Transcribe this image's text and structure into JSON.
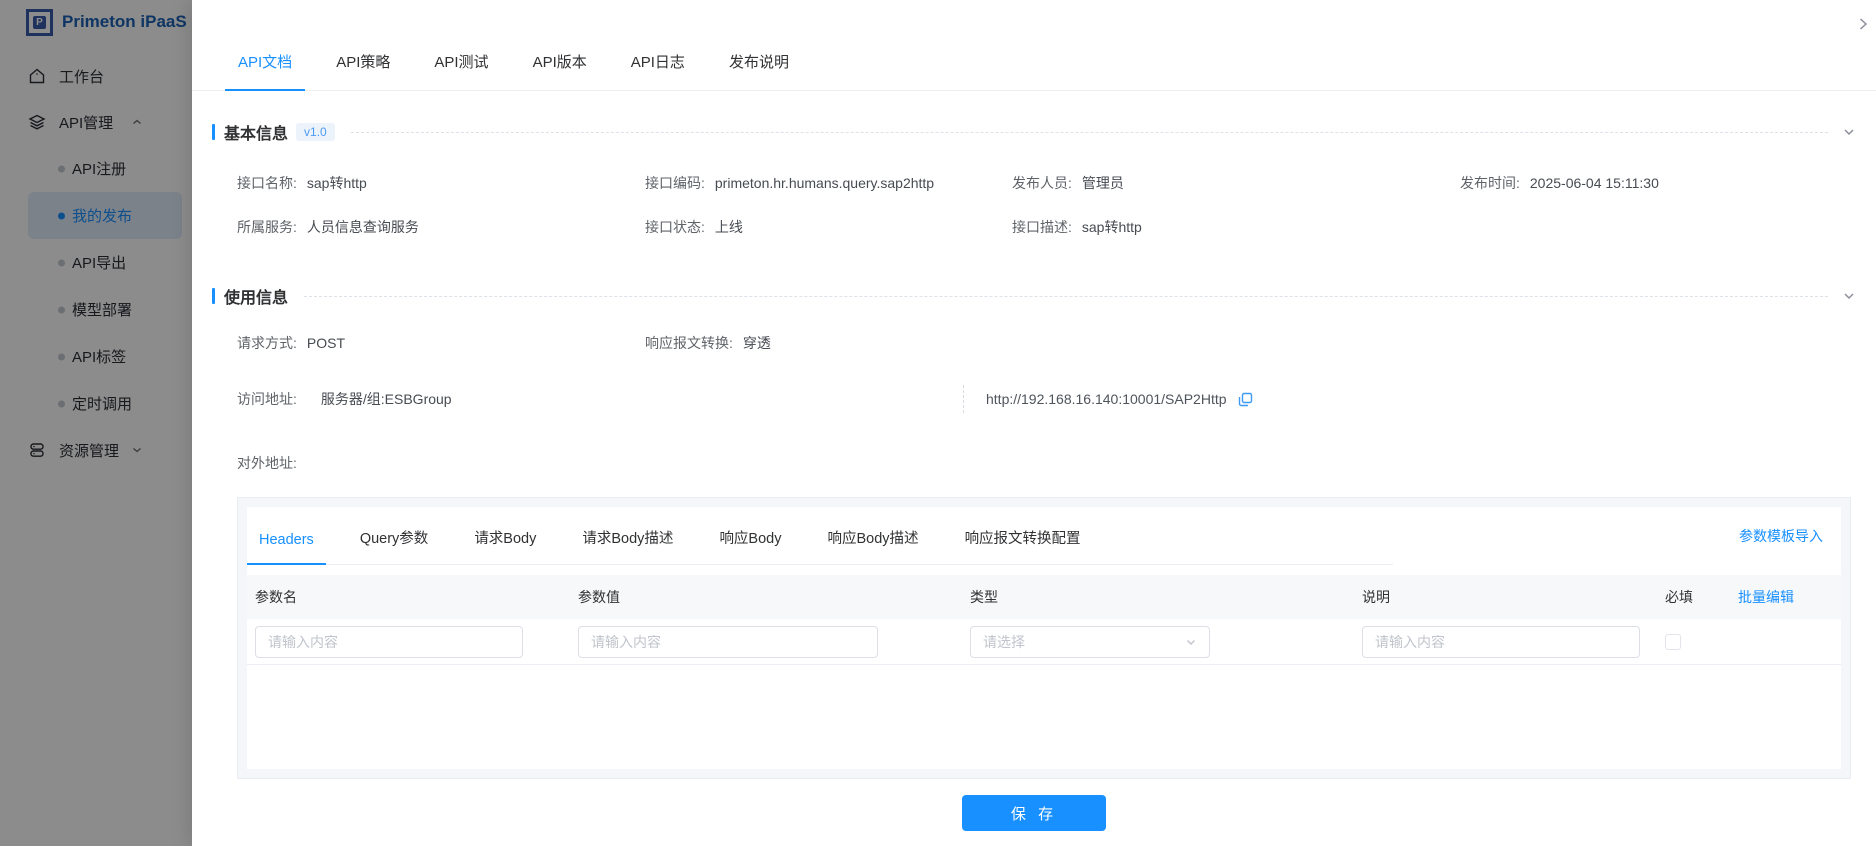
{
  "colors": {
    "accent": "#1890ff",
    "link": "#1890ff",
    "save_button_bg": "#1890ff",
    "active_menu_bg": "#e2edfb"
  },
  "icons": {
    "logo-cube-icon": "framed P cube",
    "home-icon": "house",
    "layers-icon": "stacked layers",
    "database-icon": "server stack",
    "chevron-up-icon": "^",
    "chevron-down-icon": "v",
    "chevron-right-icon": ">",
    "copy-icon": "two overlapping squares",
    "select-arrow-icon": "v"
  },
  "sidebar": {
    "logo": {
      "text": "Primeton iPaaS",
      "letter": "P"
    },
    "menu": [
      {
        "label": "工作台"
      },
      {
        "label": "API管理"
      },
      {
        "label": "资源管理"
      }
    ],
    "submenu": [
      {
        "label": "API注册"
      },
      {
        "label": "我的发布"
      },
      {
        "label": "API导出"
      },
      {
        "label": "模型部署"
      },
      {
        "label": "API标签"
      },
      {
        "label": "定时调用"
      }
    ]
  },
  "drawer": {
    "tabs": [
      "API文档",
      "API策略",
      "API测试",
      "API版本",
      "API日志",
      "发布说明"
    ],
    "basic_info": {
      "title": "基本信息",
      "version_badge": "v1.0",
      "row1": [
        {
          "label": "接口名称:",
          "value": "sap转http"
        },
        {
          "label": "接口编码:",
          "value": "primeton.hr.humans.query.sap2http"
        },
        {
          "label": "发布人员:",
          "value": "管理员"
        },
        {
          "label": "发布时间:",
          "value": "2025-06-04 15:11:30"
        }
      ],
      "row2": [
        {
          "label": "所属服务:",
          "value": "人员信息查询服务"
        },
        {
          "label": "接口状态:",
          "value": "上线"
        },
        {
          "label": "接口描述:",
          "value": "sap转http"
        }
      ]
    },
    "usage_info": {
      "title": "使用信息",
      "row1": [
        {
          "label": "请求方式:",
          "value": "POST"
        },
        {
          "label": "响应报文转换:",
          "value": "穿透"
        }
      ],
      "access": {
        "label": "访问地址:",
        "server": "服务器/组:ESBGroup",
        "url": "http://192.168.16.140:10001/SAP2Http"
      },
      "external": {
        "label": "对外地址:"
      }
    },
    "params": {
      "tabs": [
        "Headers",
        "Query参数",
        "请求Body",
        "请求Body描述",
        "响应Body",
        "响应Body描述",
        "响应报文转换配置"
      ],
      "import_link": "参数模板导入",
      "columns": [
        "参数名",
        "参数值",
        "类型",
        "说明",
        "必填"
      ],
      "batch_edit": "批量编辑",
      "input_placeholder": "请输入内容",
      "select_placeholder": "请选择"
    },
    "save_label": "保 存"
  }
}
